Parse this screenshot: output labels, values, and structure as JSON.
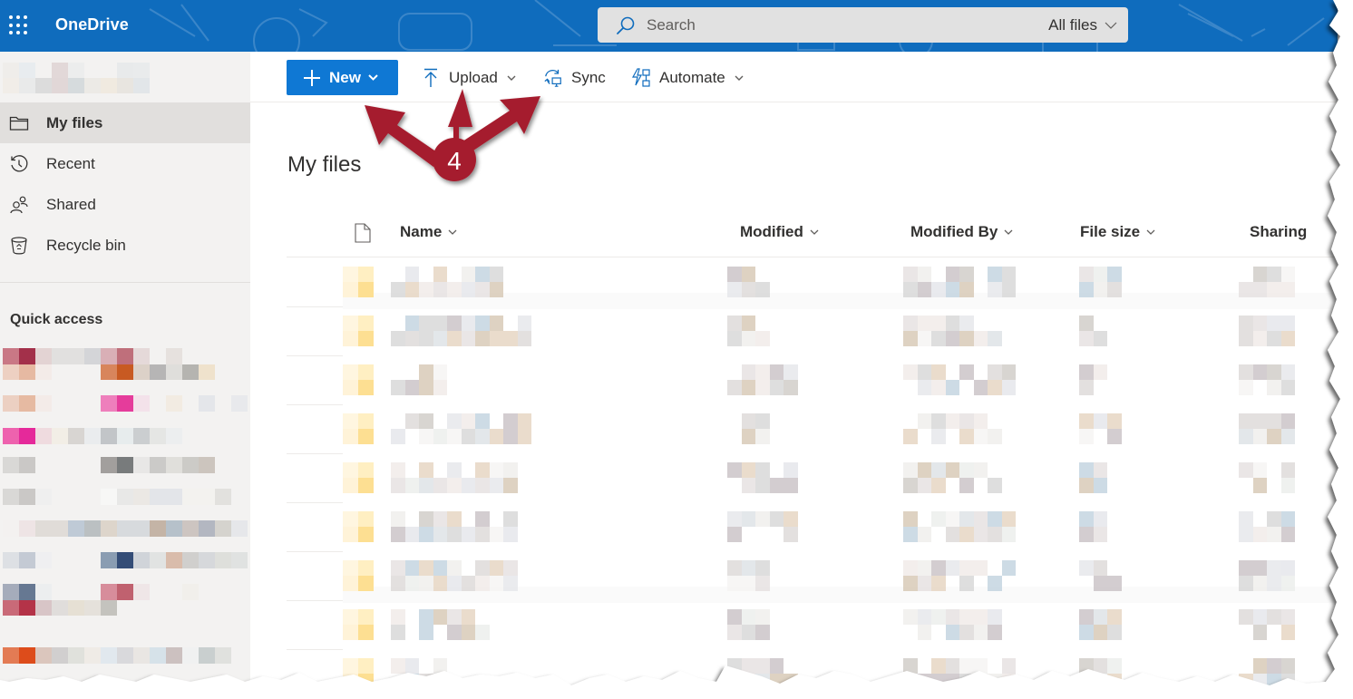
{
  "suite_header": {
    "app_launcher_icon": "waffle-icon",
    "brand": "OneDrive",
    "search": {
      "placeholder": "Search",
      "scope_label": "All files",
      "icon": "search-icon"
    },
    "colors": {
      "header_bg": "#0f6cbd",
      "search_bg": "#e1e1e1"
    }
  },
  "left_nav": {
    "items": [
      {
        "label": "My files",
        "icon": "folder-icon",
        "active": true
      },
      {
        "label": "Recent",
        "icon": "history-icon",
        "active": false
      },
      {
        "label": "Shared",
        "icon": "people-icon",
        "active": false
      },
      {
        "label": "Recycle bin",
        "icon": "recycle-bin-icon",
        "active": false
      }
    ],
    "quick_access_title": "Quick access",
    "quick_access_count": 9
  },
  "command_bar": {
    "new_label": "New",
    "upload_label": "Upload",
    "sync_label": "Sync",
    "automate_label": "Automate",
    "colors": {
      "primary": "#0f78d4"
    }
  },
  "main": {
    "title": "My files",
    "columns": [
      {
        "label": "Name",
        "sortable": true
      },
      {
        "label": "Modified",
        "sortable": true
      },
      {
        "label": "Modified By",
        "sortable": true
      },
      {
        "label": "File size",
        "sortable": true
      },
      {
        "label": "Sharing",
        "sortable": false
      }
    ],
    "rows_redacted": true,
    "visible_row_count": 9
  },
  "annotation": {
    "step_number": "4",
    "color": "#a51d2d",
    "targets": [
      "New",
      "Upload",
      "Sync"
    ]
  }
}
